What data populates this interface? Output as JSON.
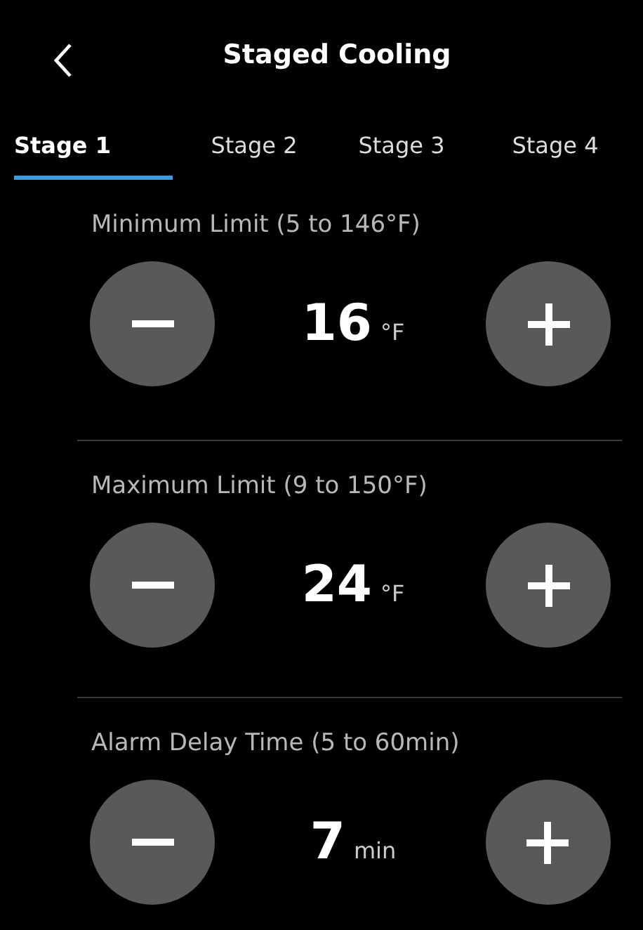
{
  "header": {
    "title": "Staged Cooling"
  },
  "tabs": [
    {
      "label": "Stage 1",
      "selected": true
    },
    {
      "label": "Stage 2",
      "selected": false
    },
    {
      "label": "Stage 3",
      "selected": false
    },
    {
      "label": "Stage 4",
      "selected": false
    }
  ],
  "settings": [
    {
      "label": "Minimum Limit (5 to 146°F)",
      "value": "16",
      "unit": "°F"
    },
    {
      "label": "Maximum Limit (9 to 150°F)",
      "value": "24",
      "unit": "°F"
    },
    {
      "label": "Alarm Delay Time (5 to 60min)",
      "value": "7",
      "unit": "min"
    }
  ]
}
